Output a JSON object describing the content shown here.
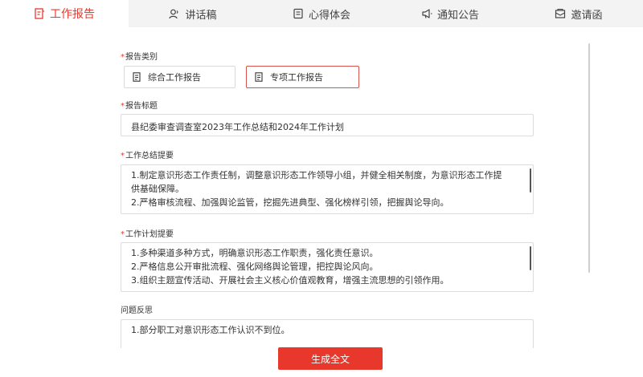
{
  "tabs": [
    {
      "label": "工作报告",
      "icon": "report-icon",
      "active": true
    },
    {
      "label": "讲话稿",
      "icon": "speaker-icon",
      "active": false
    },
    {
      "label": "心得体会",
      "icon": "note-icon",
      "active": false
    },
    {
      "label": "通知公告",
      "icon": "megaphone-icon",
      "active": false
    },
    {
      "label": "邀请函",
      "icon": "invitation-icon",
      "active": false
    }
  ],
  "form": {
    "report_type": {
      "label": "报告类别",
      "required_mark": "*",
      "options": [
        {
          "label": "综合工作报告",
          "icon": "document-icon",
          "selected": false
        },
        {
          "label": "专项工作报告",
          "icon": "document-icon",
          "selected": true
        }
      ]
    },
    "title": {
      "label": "报告标题",
      "required_mark": "*",
      "value": "县纪委审查调查室2023年工作总结和2024年工作计划"
    },
    "summary": {
      "label": "工作总结提要",
      "required_mark": "*",
      "lines": [
        "1.制定意识形态工作责任制，调整意识形态工作领导小组，并健全相关制度，为意识形态工作提",
        "供基础保障。",
        "2.严格审核流程、加强舆论监管，挖掘先进典型、强化榜样引领，把握舆论导向。"
      ]
    },
    "plan": {
      "label": "工作计划提要",
      "required_mark": "*",
      "lines": [
        "1.多种渠道多种方式，明确意识形态工作职责，强化责任意识。",
        "2.严格信息公开审批流程、强化网络舆论管理，把控舆论风向。",
        "3.组织主题宣传活动、开展社会主义核心价值观教育，增强主流思想的引领作用。"
      ]
    },
    "issues": {
      "label": "问题反思",
      "lines": [
        "1.部分职工对意识形态工作认识不到位。"
      ]
    }
  },
  "actions": {
    "generate_label": "生成全文"
  },
  "colors": {
    "accent": "#e8382c",
    "tab_bar_bg": "#f3f3f3",
    "border": "#dcdcdc"
  }
}
